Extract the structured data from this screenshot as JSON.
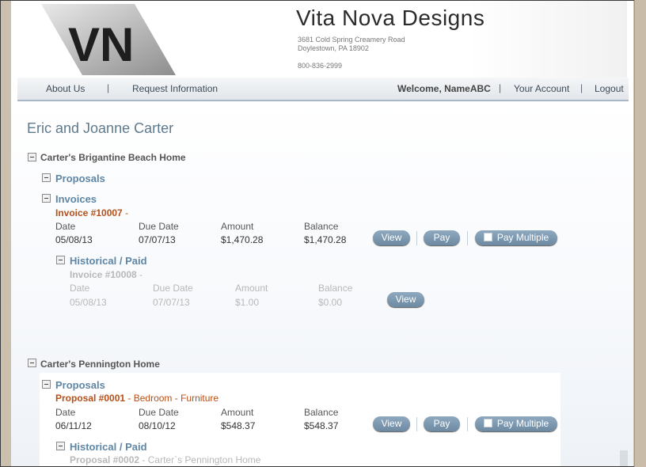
{
  "header": {
    "brand": "Vita Nova Designs",
    "address_line1": "3681 Cold Spring Creamery Road",
    "address_line2": "Doylestown, PA 18902",
    "phone": "800-836-2999",
    "logo_text": "VN"
  },
  "nav": {
    "about": "About Us",
    "sep": "|",
    "request": "Request Information",
    "welcome": "Welcome, NameABC",
    "account": "Your Account",
    "logout": "Logout"
  },
  "customer": "Eric and Joanne Carter",
  "projects": [
    {
      "name": "Carter's Brigantine Beach Home",
      "proposals_label": "Proposals",
      "invoices_label": "Invoices",
      "invoice": {
        "number": "Invoice #10007",
        "suffix": " -",
        "headers": [
          "Date",
          "Due Date",
          "Amount",
          "Balance"
        ],
        "values": [
          "05/08/13",
          "07/07/13",
          "$1,470.28",
          "$1,470.28"
        ]
      },
      "historical": {
        "label": "Historical / Paid",
        "number": "Invoice #10008",
        "suffix": " -",
        "headers": [
          "Date",
          "Due Date",
          "Amount",
          "Balance"
        ],
        "values": [
          "05/08/13",
          "07/07/13",
          "$1.00",
          "$0.00"
        ]
      }
    },
    {
      "name": "Carter's Pennington Home",
      "proposals_label": "Proposals",
      "proposal": {
        "number": "Proposal #0001",
        "suffix": " - Bedroom - Furniture",
        "headers": [
          "Date",
          "Due Date",
          "Amount",
          "Balance"
        ],
        "values": [
          "06/11/12",
          "08/10/12",
          "$548.37",
          "$548.37"
        ]
      },
      "historical": {
        "label": "Historical / Paid",
        "number": "Proposal #0002",
        "suffix": " - Carter`s Pennington Home"
      }
    }
  ],
  "buttons": {
    "view": "View",
    "pay": "Pay",
    "pay_multiple": "Pay Multiple"
  },
  "colors": {
    "accent": "#5e86a5",
    "invoice_link": "#b5501a",
    "button": "#7d98b0"
  }
}
